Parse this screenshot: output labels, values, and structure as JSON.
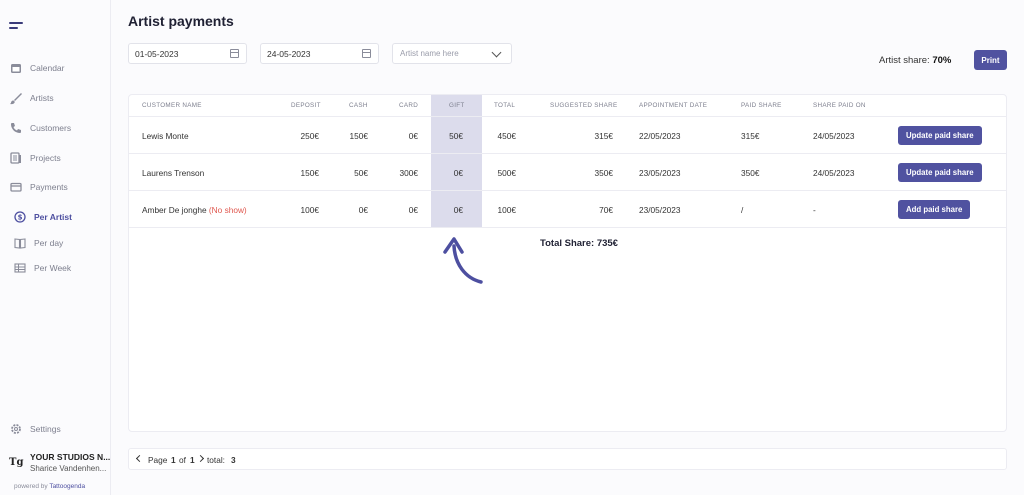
{
  "sidebar": {
    "items": [
      {
        "label": "Calendar",
        "icon": "calendar-icon"
      },
      {
        "label": "Artists",
        "icon": "brush-icon"
      },
      {
        "label": "Customers",
        "icon": "phone-icon"
      },
      {
        "label": "Projects",
        "icon": "projects-icon"
      },
      {
        "label": "Payments",
        "icon": "payments-icon"
      }
    ],
    "sub_items": [
      {
        "label": "Per Artist",
        "icon": "dollar-icon",
        "active": true
      },
      {
        "label": "Per day",
        "icon": "book-icon",
        "active": false
      },
      {
        "label": "Per Week",
        "icon": "table-icon",
        "active": false
      }
    ],
    "settings_label": "Settings",
    "studio_name": "YOUR STUDIOS N...",
    "studio_user": "Sharice Vandenhen...",
    "powered_by": "powered by",
    "brand": "Tattoogenda",
    "logo_text": "Tg"
  },
  "main": {
    "title": "Artist payments",
    "date_from": "01-05-2023",
    "date_to": "24-05-2023",
    "artist_placeholder": "Artist name here",
    "artist_share_label": "Artist share:",
    "artist_share_value": "70%",
    "print_label": "Print"
  },
  "table": {
    "headers": [
      "CUSTOMER NAME",
      "DEPOSIT",
      "CASH",
      "CARD",
      "GIFT",
      "TOTAL",
      "SUGGESTED SHARE",
      "APPOINTMENT DATE",
      "PAID SHARE",
      "SHARE PAID ON"
    ],
    "rows": [
      {
        "customer": "Lewis Monte",
        "note": "",
        "deposit": "250€",
        "cash": "150€",
        "card": "0€",
        "gift": "50€",
        "total": "450€",
        "suggested": "315€",
        "date": "22/05/2023",
        "paid": "315€",
        "paid_on": "24/05/2023",
        "action": "Update paid share"
      },
      {
        "customer": "Laurens Trenson",
        "note": "",
        "deposit": "150€",
        "cash": "50€",
        "card": "300€",
        "gift": "0€",
        "total": "500€",
        "suggested": "350€",
        "date": "23/05/2023",
        "paid": "350€",
        "paid_on": "24/05/2023",
        "action": "Update paid share"
      },
      {
        "customer": "Amber De jonghe",
        "note": "(No show)",
        "deposit": "100€",
        "cash": "0€",
        "card": "0€",
        "gift": "0€",
        "total": "100€",
        "suggested": "70€",
        "date": "23/05/2023",
        "paid": "/",
        "paid_on": "-",
        "action": "Add paid share"
      }
    ],
    "total_share": "Total Share: 735€"
  },
  "pagination": {
    "page_label": "Page",
    "page": "1",
    "of_label": "of",
    "pages": "1",
    "total_label": "total:",
    "total": "3"
  },
  "colors": {
    "accent": "#5052a0",
    "highlight": "#dcdcec",
    "no_show": "#e0584f"
  }
}
